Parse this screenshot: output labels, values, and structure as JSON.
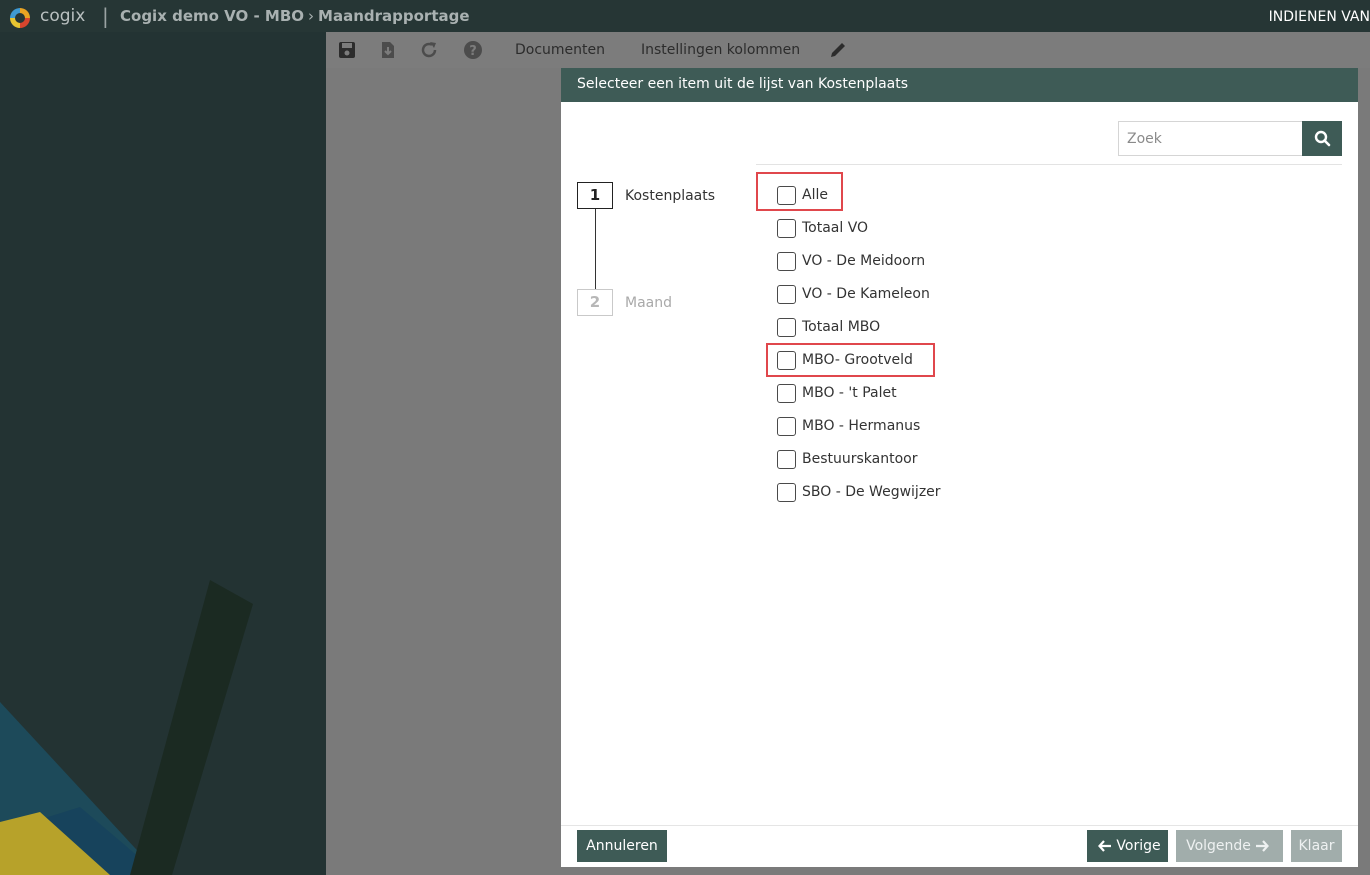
{
  "header": {
    "brand": "cogix",
    "separator": "|",
    "breadcrumb": [
      "Cogix demo VO - MBO",
      "Maandrapportage"
    ],
    "breadcrumb_separator": "›",
    "submit_label": "INDIENEN VAN"
  },
  "toolbar": {
    "icons": [
      "save-icon",
      "download-icon",
      "refresh-icon",
      "help-icon",
      "pencil-icon"
    ],
    "documents_label": "Documenten",
    "columns_label": "Instellingen kolommen"
  },
  "modal": {
    "title": "Selecteer een item uit de lijst van Kostenplaats",
    "search": {
      "placeholder": "Zoek",
      "value": ""
    },
    "steps": [
      {
        "number": "1",
        "label": "Kostenplaats",
        "active": true
      },
      {
        "number": "2",
        "label": "Maand",
        "active": false
      }
    ],
    "options": [
      {
        "label": "Alle",
        "checked": false
      },
      {
        "label": "Totaal VO",
        "checked": false
      },
      {
        "label": "VO - De Meidoorn",
        "checked": false
      },
      {
        "label": "VO - De Kameleon",
        "checked": false
      },
      {
        "label": "Totaal MBO",
        "checked": false
      },
      {
        "label": "MBO- Grootveld",
        "checked": false
      },
      {
        "label": "MBO - 't Palet",
        "checked": false
      },
      {
        "label": "MBO - Hermanus",
        "checked": false
      },
      {
        "label": "Bestuurskantoor",
        "checked": false
      },
      {
        "label": "SBO - De Wegwijzer",
        "checked": false
      }
    ],
    "highlighted_options": [
      "Alle",
      "MBO- Grootveld"
    ],
    "buttons": {
      "cancel": "Annuleren",
      "previous": "Vorige",
      "next": "Volgende",
      "done": "Klaar"
    }
  },
  "colors": {
    "accent": "#3e5b56",
    "highlight": "#e0474c",
    "topbar": "#263635",
    "overlay": "#7a7a7a",
    "disabled": "#a1adab"
  }
}
